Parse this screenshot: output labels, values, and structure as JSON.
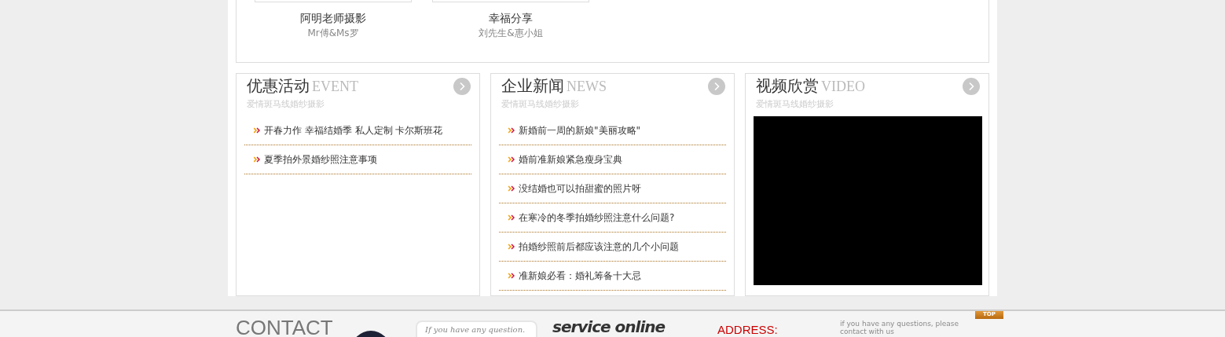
{
  "gallery": [
    {
      "title": "阿明老师摄影",
      "subtitle": "Mr傅&Ms罗"
    },
    {
      "title": "幸福分享",
      "subtitle": "刘先生&惠小姐"
    }
  ],
  "panels": [
    {
      "kind": "list",
      "title": "优惠活动",
      "title_en": "EVENT",
      "subtitle": "爱情斑马线婚纱摄影",
      "items": [
        "开春力作 幸福结婚季 私人定制 卡尔斯班花",
        "夏季拍外景婚纱照注意事项"
      ]
    },
    {
      "kind": "list",
      "title": "企业新闻",
      "title_en": "NEWS",
      "subtitle": "爱情斑马线婚纱摄影",
      "items": [
        "新婚前一周的新娘\"美丽攻略\"",
        "婚前准新娘紧急瘦身宝典",
        "没结婚也可以拍甜蜜的照片呀",
        "在寒冷的冬季拍婚纱照注意什么问题?",
        "拍婚纱照前后都应该注意的几个小问题",
        "准新娘必看：婚礼筹备十大忌"
      ]
    },
    {
      "kind": "video",
      "title": "视频欣赏",
      "title_en": "VIDEO",
      "subtitle": "爱情斑马线婚纱摄影"
    }
  ],
  "footer": {
    "heading": "CONTACT",
    "bubble": "If you have any question.",
    "service": "service online",
    "address_label": "ADDRESS:",
    "note": "if you have any questions, please contact with us",
    "top_button": "TOP"
  }
}
